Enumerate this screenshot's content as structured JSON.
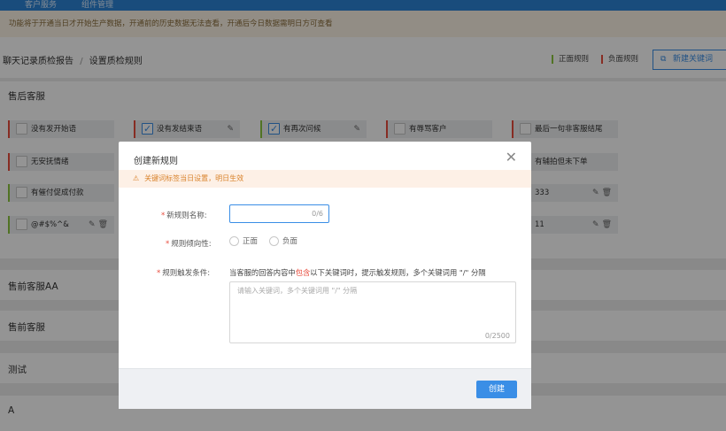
{
  "topbar": {
    "tab1": "客户服务",
    "tab2": "组件管理"
  },
  "notice": "功能将于开通当日才开始生产数据，开通前的历史数据无法查看，开通后今日数据需明日方可查看",
  "breadcrumb": {
    "parent": "聊天记录质检报告",
    "separator": "/",
    "current": "设置质检规则"
  },
  "legend": {
    "positive": "正面规则",
    "negative": "负面规则"
  },
  "new_keyword_button": "新建关键词",
  "colors": {
    "accent": "#3a8ee6",
    "positive": "#8cc63f",
    "negative": "#e84c3d",
    "warning": "#d9822b"
  },
  "groups": [
    {
      "title": "售后客服",
      "rules": [
        {
          "label": "没有发开始语",
          "checked": false,
          "polarity": "negative"
        },
        {
          "label": "没有发结束语",
          "checked": true,
          "polarity": "negative"
        },
        {
          "label": "有再次问候",
          "checked": true,
          "polarity": "positive"
        },
        {
          "label": "有辱骂客户",
          "checked": false,
          "polarity": "negative"
        },
        {
          "label": "最后一句非客服结尾",
          "checked": false,
          "polarity": "negative"
        },
        {
          "label": "无安抚情绪",
          "checked": false,
          "polarity": "negative"
        },
        {
          "label": "有辅拍但未下单",
          "checked": false,
          "polarity": "negative"
        },
        {
          "label": "有催付促成付款",
          "checked": false,
          "polarity": "positive"
        },
        {
          "label": "333",
          "checked": false,
          "polarity": "negative"
        },
        {
          "label": "@#$%^&",
          "checked": false,
          "polarity": "positive"
        },
        {
          "label": "11",
          "checked": false,
          "polarity": "negative"
        }
      ]
    },
    {
      "title": "售前客服AA"
    },
    {
      "title": "售前客服"
    },
    {
      "title": "测试"
    },
    {
      "title": "A"
    }
  ],
  "modal": {
    "title": "创建新规则",
    "close_icon": "close-icon",
    "warning": "关键词标签当日设置，明日生效",
    "name_label": "新规则名称:",
    "name_counter": "0/6",
    "polarity_label": "规则倾向性:",
    "polarity_options": [
      "正面",
      "负面"
    ],
    "condition_label": "规则触发条件:",
    "condition_desc_pre": "当客服的回答内容中",
    "condition_desc_highlight": "包含",
    "condition_desc_post": "以下关键词时，提示触发规则，多个关键词用 \"/\" 分隔",
    "condition_placeholder": "请输入关键词，多个关键词用 \"/\" 分隔",
    "condition_counter": "0/2500",
    "create_button": "创建"
  }
}
